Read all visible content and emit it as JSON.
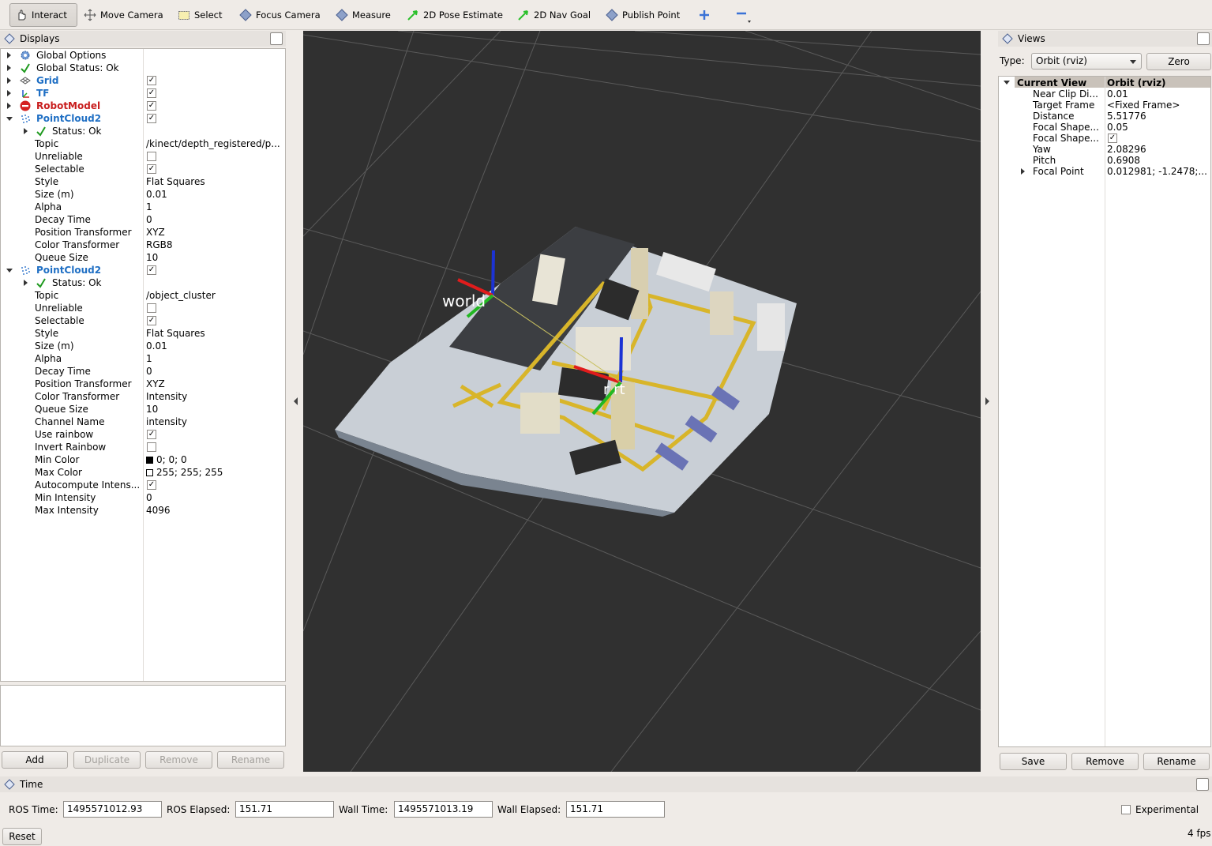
{
  "toolbar": {
    "interact": "Interact",
    "move_camera": "Move Camera",
    "select": "Select",
    "focus_camera": "Focus Camera",
    "measure": "Measure",
    "pose_estimate": "2D Pose Estimate",
    "nav_goal": "2D Nav Goal",
    "publish_point": "Publish Point"
  },
  "displays": {
    "title": "Displays",
    "items": [
      {
        "label": "Global Options"
      },
      {
        "label": "Global Status: Ok"
      },
      {
        "label": "Grid"
      },
      {
        "label": "TF"
      },
      {
        "label": "RobotModel"
      },
      {
        "label": "PointCloud2"
      },
      {
        "label": "Status: Ok"
      }
    ],
    "pc1": {
      "topic_k": "Topic",
      "topic_v": "/kinect/depth_registered/p...",
      "unreliable_k": "Unreliable",
      "selectable_k": "Selectable",
      "style_k": "Style",
      "style_v": "Flat Squares",
      "size_k": "Size (m)",
      "size_v": "0.01",
      "alpha_k": "Alpha",
      "alpha_v": "1",
      "decay_k": "Decay Time",
      "decay_v": "0",
      "pos_k": "Position Transformer",
      "pos_v": "XYZ",
      "color_k": "Color Transformer",
      "color_v": "RGB8",
      "queue_k": "Queue Size",
      "queue_v": "10"
    },
    "pc2": {
      "label": "PointCloud2",
      "status": "Status: Ok",
      "topic_k": "Topic",
      "topic_v": "/object_cluster",
      "unreliable_k": "Unreliable",
      "selectable_k": "Selectable",
      "style_k": "Style",
      "style_v": "Flat Squares",
      "size_k": "Size (m)",
      "size_v": "0.01",
      "alpha_k": "Alpha",
      "alpha_v": "1",
      "decay_k": "Decay Time",
      "decay_v": "0",
      "pos_k": "Position Transformer",
      "pos_v": "XYZ",
      "color_k": "Color Transformer",
      "color_v": "Intensity",
      "queue_k": "Queue Size",
      "queue_v": "10",
      "channel_k": "Channel Name",
      "channel_v": "intensity",
      "rainbow_k": "Use rainbow",
      "invert_k": "Invert Rainbow",
      "mincolor_k": "Min Color",
      "mincolor_v": "0; 0; 0",
      "maxcolor_k": "Max Color",
      "maxcolor_v": "255; 255; 255",
      "autocompute_k": "Autocompute Intens...",
      "minint_k": "Min Intensity",
      "minint_v": "0",
      "maxint_k": "Max Intensity",
      "maxint_v": "4096"
    },
    "buttons": {
      "add": "Add",
      "duplicate": "Duplicate",
      "remove": "Remove",
      "rename": "Rename"
    }
  },
  "viewport": {
    "frame_world": "world",
    "frame_robot": "r    rt"
  },
  "views": {
    "title": "Views",
    "type_label": "Type:",
    "type_value": "Orbit (rviz)",
    "zero": "Zero",
    "header_k": "Current View",
    "header_v": "Orbit (rviz)",
    "rows": [
      {
        "k": "Near Clip Di...",
        "v": "0.01"
      },
      {
        "k": "Target Frame",
        "v": "<Fixed Frame>"
      },
      {
        "k": "Distance",
        "v": "5.51776"
      },
      {
        "k": "Focal Shape...",
        "v": "0.05"
      },
      {
        "k": "Focal Shape...",
        "v": ""
      },
      {
        "k": "Yaw",
        "v": "2.08296"
      },
      {
        "k": "Pitch",
        "v": "0.6908"
      },
      {
        "k": "Focal Point",
        "v": "0.012981; -1.2478;..."
      }
    ],
    "buttons": {
      "save": "Save",
      "remove": "Remove",
      "rename": "Rename"
    }
  },
  "time": {
    "title": "Time",
    "ros_time_label": "ROS Time:",
    "ros_time": "1495571012.93",
    "ros_elapsed_label": "ROS Elapsed:",
    "ros_elapsed": "151.71",
    "wall_time_label": "Wall Time:",
    "wall_time": "1495571013.19",
    "wall_elapsed_label": "Wall Elapsed:",
    "wall_elapsed": "151.71",
    "experimental": "Experimental",
    "reset": "Reset",
    "fps": "4 fps"
  },
  "colors": {
    "accent_blue": "#1f6fc4",
    "error_red": "#c81e1e",
    "viewport_bg": "#303030"
  }
}
